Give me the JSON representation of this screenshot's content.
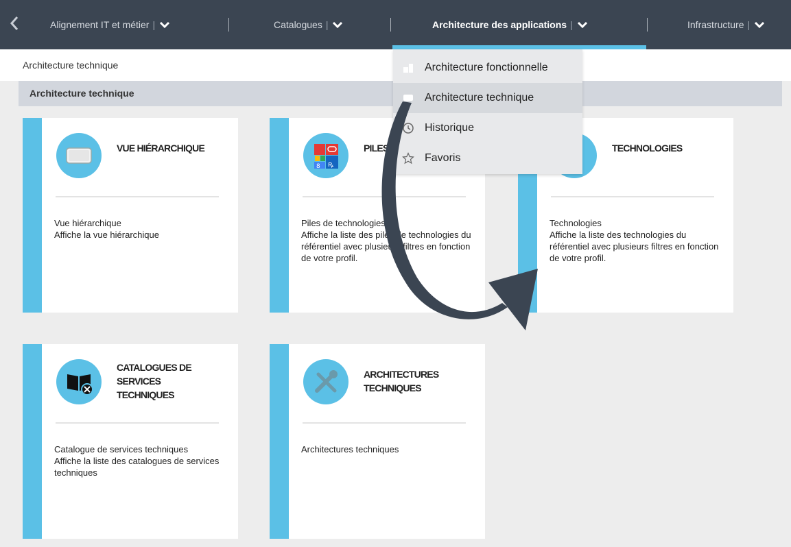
{
  "nav": {
    "back_icon": "chevron-left-icon",
    "items": [
      {
        "label": "Alignement IT et métier",
        "pipe": "|"
      },
      {
        "label": "Catalogues",
        "pipe": "|"
      },
      {
        "label": "Architecture des applications",
        "pipe": "|"
      },
      {
        "label": "Infrastructure",
        "pipe": "|"
      }
    ],
    "active_index": 2
  },
  "breadcrumb": "Architecture technique",
  "section": {
    "title": "Architecture technique"
  },
  "cards": [
    {
      "title": "VUE HIÉRARCHIQUE",
      "icon": "hierarchy-view-icon",
      "desc1": "Vue hiérarchique",
      "desc2": "Affiche la vue hiérarchique"
    },
    {
      "title": "PILES DE TECHNOLOGIES",
      "icon": "technology-stack-icon",
      "desc1": "Piles de technologies",
      "desc2": "Affiche la liste des piles de technologies du référentiel avec plusieurs filtres en fonction de votre profil."
    },
    {
      "title": "TECHNOLOGIES",
      "icon": "technology-icon",
      "desc1": "Technologies",
      "desc2": "Affiche la liste des technologies du référentiel avec plusieurs filtres en fonction de votre profil."
    },
    {
      "title": "CATALOGUES DE SERVICES TECHNIQUES",
      "icon": "service-catalog-icon",
      "desc1": "Catalogue de services techniques",
      "desc2": "Affiche la liste des catalogues de services techniques"
    },
    {
      "title": "ARCHITECTURES TECHNIQUES",
      "icon": "tools-icon",
      "desc1": "Architectures techniques",
      "desc2": ""
    }
  ],
  "dropdown": {
    "items": [
      {
        "label": "Architecture fonctionnelle",
        "icon": "functional-architecture-icon"
      },
      {
        "label": "Architecture technique",
        "icon": "technical-architecture-icon"
      },
      {
        "label": "Historique",
        "icon": "history-icon"
      },
      {
        "label": "Favoris",
        "icon": "star-icon"
      }
    ],
    "hovered_index": 1
  },
  "colors": {
    "nav_bg": "#3b4552",
    "accent": "#5bc0e6",
    "arrow": "#3b4552"
  }
}
